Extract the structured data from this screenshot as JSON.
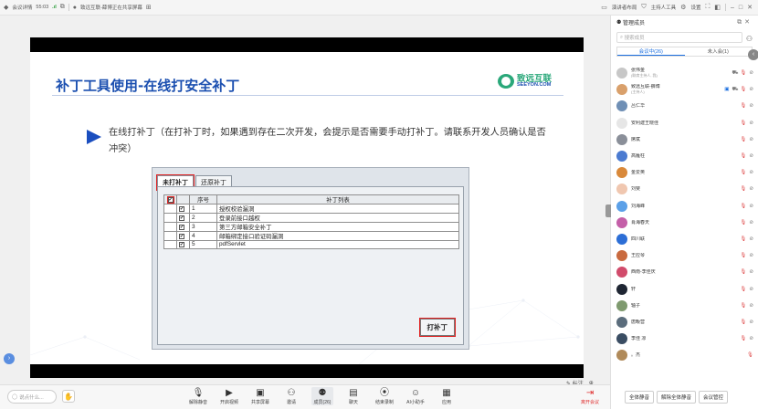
{
  "topbar": {
    "left": {
      "app": "会议详情",
      "time": "55:03",
      "network": ".ıl",
      "sharing": "致远互联-薛博正在共享屏幕",
      "grid_icon": "grid-icon"
    },
    "right": {
      "speaker_layout": "演讲者布局",
      "host_tools": "主持人工具",
      "settings": "设置"
    }
  },
  "slide": {
    "title": "补丁工具使用-在线打安全补丁",
    "logo_cn": "致远互联",
    "logo_en": "SEEYON.COM",
    "bullet": "在线打补丁（在打补丁时，如果遇到存在二次开发，会提示是否需要手动打补丁。请联系开发人员确认是否冲突）",
    "dialog": {
      "tabs": [
        "未打补丁",
        "还原补丁"
      ],
      "columns": [
        "",
        "",
        "序号",
        "补丁列表"
      ],
      "rows": [
        {
          "no": "1",
          "name": "授权校验漏洞"
        },
        {
          "no": "2",
          "name": "登录前接口越权"
        },
        {
          "no": "3",
          "name": "第三方邮箱安全补丁"
        },
        {
          "no": "4",
          "name": "邮箱绑定接口验证码漏洞"
        },
        {
          "no": "5",
          "name": "pdfServlet"
        }
      ],
      "button": "打补丁"
    }
  },
  "stage": {
    "annotate": "标注"
  },
  "bottombar": {
    "say_placeholder": "说点什么...",
    "tools": [
      {
        "label": "解除静音",
        "icon": "mic-off-icon"
      },
      {
        "label": "开启视频",
        "icon": "camera-off-icon"
      },
      {
        "label": "共享屏幕",
        "icon": "screen-share-icon"
      },
      {
        "label": "邀请",
        "icon": "invite-icon"
      },
      {
        "label": "成员(26)",
        "icon": "members-icon"
      },
      {
        "label": "聊天",
        "icon": "chat-icon"
      },
      {
        "label": "结束录制",
        "icon": "record-icon"
      },
      {
        "label": "AI小助手",
        "icon": "ai-icon"
      },
      {
        "label": "应用",
        "icon": "apps-icon"
      }
    ],
    "leave": "离开会议"
  },
  "panel": {
    "title": "管理成员",
    "search_placeholder": "搜索成员",
    "tabs": [
      "会议中(26)",
      "未入会(1)"
    ],
    "members": [
      {
        "name": "张伟金",
        "sub": "(联席主持人, 我)",
        "color": "#c7c7c7"
      },
      {
        "name": "致远互联-薛博",
        "sub": "(主持人)",
        "color": "#d9a06b",
        "sharing": true
      },
      {
        "name": "吕仁华",
        "sub": "",
        "color": "#6f8fb5"
      },
      {
        "name": "安利建王晓佳",
        "sub": "",
        "color": "#e6e6e6"
      },
      {
        "name": "席斌",
        "sub": "",
        "color": "#8a8f99"
      },
      {
        "name": "高雁柱",
        "sub": "",
        "color": "#4b7bd1"
      },
      {
        "name": "金爱英",
        "sub": "",
        "color": "#d9893a"
      },
      {
        "name": "刘斐",
        "sub": "",
        "color": "#f0c7b0"
      },
      {
        "name": "刘海峰",
        "sub": "",
        "color": "#5ba0e8"
      },
      {
        "name": "肖海春天",
        "sub": "",
        "color": "#c45fa8"
      },
      {
        "name": "四川联",
        "sub": "",
        "color": "#2c6ed6"
      },
      {
        "name": "王应琴",
        "sub": "",
        "color": "#c96a3f"
      },
      {
        "name": "西南-李佳庆",
        "sub": "",
        "color": "#d14b6b"
      },
      {
        "name": "轩",
        "sub": "",
        "color": "#1f2633"
      },
      {
        "name": "轴子",
        "sub": "",
        "color": "#7f9a6f"
      },
      {
        "name": "唐畈营",
        "sub": "",
        "color": "#5b6d7c"
      },
      {
        "name": "李佳 凉",
        "sub": "",
        "color": "#3a4d63"
      },
      {
        "name": "。杰",
        "sub": "",
        "color": "#b08a5a"
      }
    ],
    "footer": [
      "全体静音",
      "解除全体静音",
      "会议管控"
    ]
  }
}
